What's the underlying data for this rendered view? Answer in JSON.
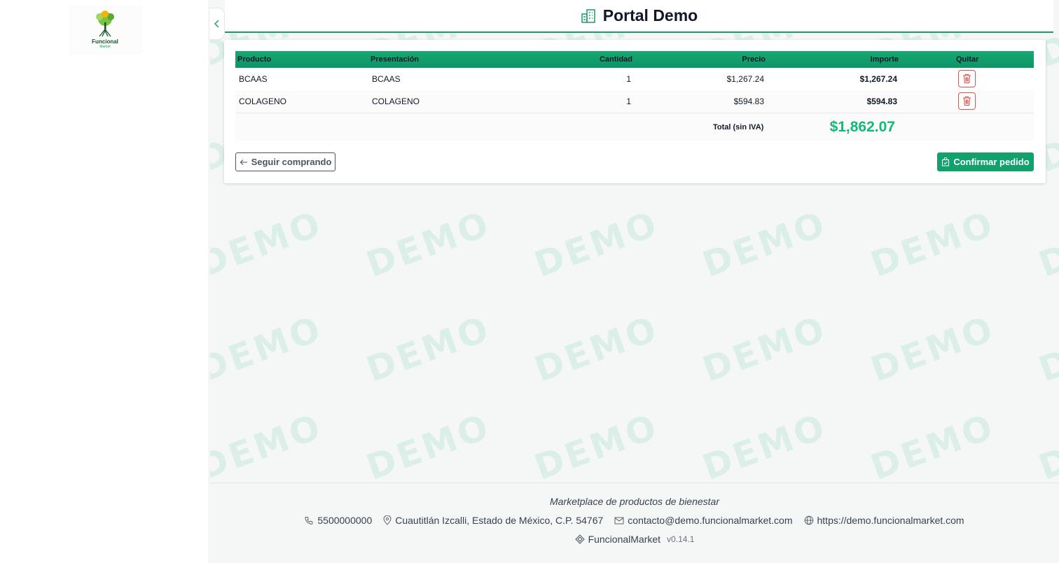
{
  "sidebar": {
    "logo": {
      "name": "Funcional",
      "sub": "Market"
    }
  },
  "header": {
    "title": "Portal Demo"
  },
  "watermark_text": "DEMO",
  "cart": {
    "columns": {
      "product": "Producto",
      "presentation": "Presentación",
      "quantity": "Cantidad",
      "price": "Precio",
      "amount": "Importe",
      "remove": "Quitar"
    },
    "items": [
      {
        "product": "BCAAS",
        "presentation": "BCAAS",
        "quantity": "1",
        "price": "$1,267.24",
        "amount": "$1,267.24"
      },
      {
        "product": "COLAGENO",
        "presentation": "COLAGENO",
        "quantity": "1",
        "price": "$594.83",
        "amount": "$594.83"
      }
    ],
    "total_label": "Total (sin IVA)",
    "total_value": "$1,862.07"
  },
  "actions": {
    "back_label": "Seguir comprando",
    "confirm_label": "Confirmar pedido"
  },
  "footer": {
    "tagline": "Marketplace de productos de bienestar",
    "phone": "5500000000",
    "address": "Cuautitlán Izcalli, Estado de México, C.P. 54767",
    "email": "contacto@demo.funcionalmarket.com",
    "website": "https://demo.funcionalmarket.com",
    "brand": "FuncionalMarket",
    "version": "v0.14.1"
  },
  "colors": {
    "brand_green": "#12a06c",
    "total_green": "#14b877",
    "danger_red": "#d9534f"
  }
}
